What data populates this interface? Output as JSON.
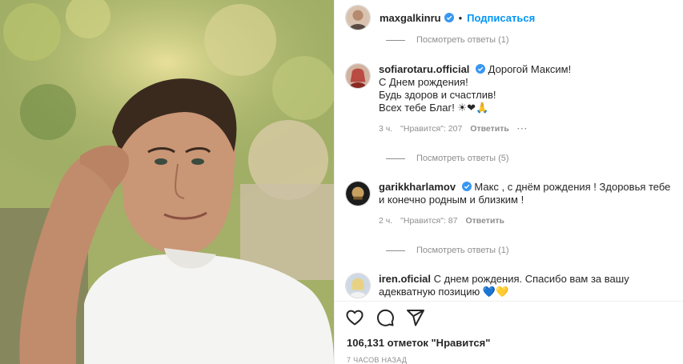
{
  "post": {
    "author": "maxgalkinru",
    "follow_label": "Подписаться",
    "separator": "•",
    "likes_text": "106,131 отметок \"Нравится\"",
    "time_ago": "7 ЧАСОВ НАЗАД"
  },
  "comments": [
    {
      "replies_label": "Посмотреть ответы (1)"
    },
    {
      "username": "sofiarotaru.official",
      "lines": [
        "Дорогой Максим!",
        "С Днем рождения!",
        "Будь здоров и счастлив!",
        "Всех тебе Благ! ☀❤🙏"
      ],
      "time": "3 ч.",
      "likes": "\"Нравится\": 207",
      "reply_label": "Ответить",
      "more": "···",
      "replies_label": "Посмотреть ответы (5)"
    },
    {
      "username": "garikkharlamov",
      "lines": [
        "Макс , с днём рождения ! Здоровья тебе",
        "и конечно родным и близким !"
      ],
      "time": "2 ч.",
      "likes": "\"Нравится\": 87",
      "reply_label": "Ответить",
      "replies_label": "Посмотреть ответы (1)"
    },
    {
      "username": "iren.oficial",
      "lines": [
        "С днем рождения. Спасибо вам за вашу",
        "адекватную позицию 💙💛"
      ]
    }
  ],
  "icons": [
    "heart-icon",
    "comment-icon",
    "share-icon",
    "verified-icon"
  ],
  "colors": {
    "accent": "#0095f6",
    "text": "#262626",
    "muted": "#8e8e8e",
    "verified": "#3897f0"
  }
}
